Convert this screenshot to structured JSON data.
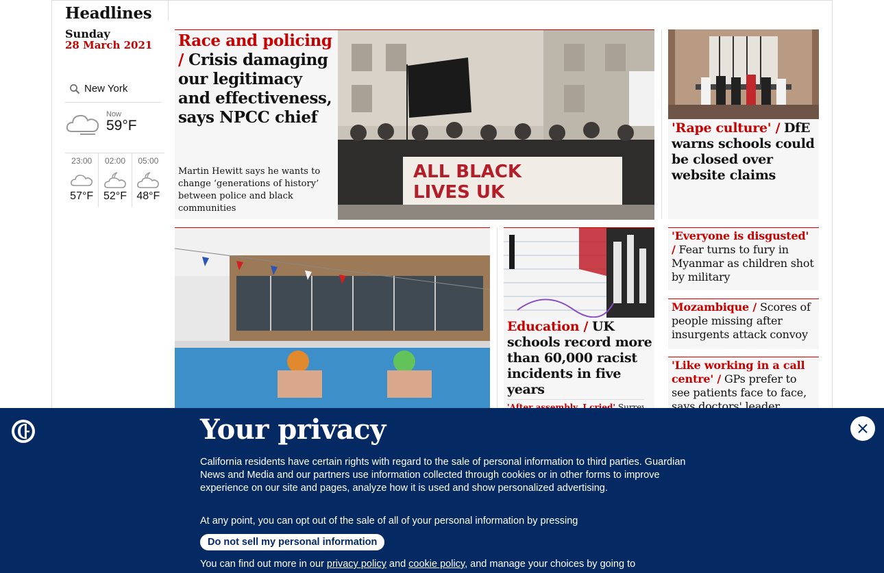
{
  "section": {
    "title": "Headlines",
    "day": "Sunday",
    "date": "28 March 2021"
  },
  "weather": {
    "location": "New York",
    "now_label": "Now",
    "now_temp": "59°F",
    "now_icon": "cloud-icon",
    "forecast": [
      {
        "time": "23:00",
        "temp": "57°F",
        "icon": "cloud-icon"
      },
      {
        "time": "02:00",
        "temp": "52°F",
        "icon": "moon-cloud-icon"
      },
      {
        "time": "05:00",
        "temp": "48°F",
        "icon": "moon-cloud-icon"
      }
    ]
  },
  "lead": {
    "kicker": "Race and policing /",
    "headline": "Crisis damaging our legitimacy and effectiveness, says NPCC chief",
    "standfirst": "Martin Hewitt says he wants to change ‘generations of history’ between police and black communities",
    "image_alt": "ALL BLACK LIVES UK"
  },
  "right_top": {
    "kicker": "'Rape culture' /",
    "headline": "DfE warns schools could be closed over website claims"
  },
  "education": {
    "kicker": "Education /",
    "headline": "UK schools record more than 60,000 racist incidents in five years",
    "sub_kicker": "'After assembly, I cried'",
    "sub_text": "Surrey"
  },
  "right_list": [
    {
      "kicker": "'Everyone is disgusted' /",
      "headline": "Fear turns to fury in Myanmar as children shot by military"
    },
    {
      "kicker": "Mozambique /",
      "headline": "Scores of people missing after insurgents attack convoy"
    },
    {
      "kicker": "'Like working in a call centre' /",
      "headline": "GPs prefer to see patients face to face, says doctors' leader"
    }
  ],
  "privacy": {
    "title": "Your privacy",
    "p1": "California residents have certain rights with regard to the sale of personal information to third parties. Guardian News and Media and our partners use information collected through cookies or in other forms to improve experience on our site and pages, analyze how it is used and show personalized advertising.",
    "p2": "At any point, you can opt out of the sale of all of your personal information by pressing",
    "button": "Do not sell my personal information",
    "p3_a": "You can find out more in our ",
    "privacy_link": "privacy policy",
    "p3_b": " and ",
    "cookie_link": "cookie policy",
    "p3_c": ", and manage your choices by going to"
  },
  "colors": {
    "accent": "#c70000",
    "privacy_bg": "#052962",
    "card_bg": "#f6f6f6"
  }
}
